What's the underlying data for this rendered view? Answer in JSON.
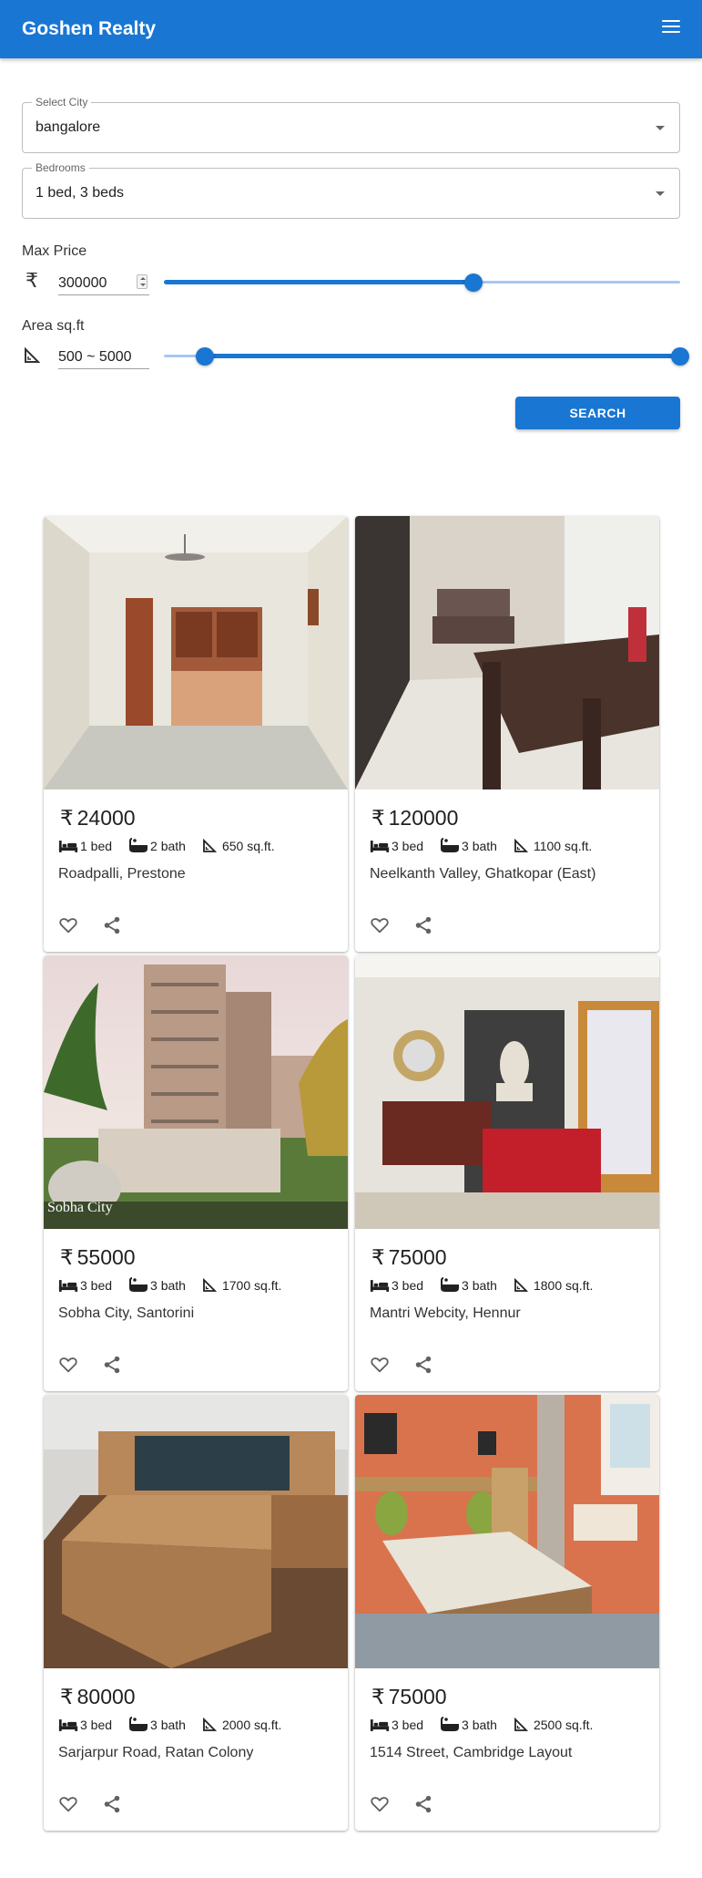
{
  "app": {
    "title": "Goshen Realty"
  },
  "filters": {
    "city": {
      "label": "Select City",
      "value": "bangalore"
    },
    "bedrooms": {
      "label": "Bedrooms",
      "value": "1 bed, 3 beds"
    },
    "max_price": {
      "label": "Max Price",
      "currency": "₹",
      "value": "300000",
      "slider_fraction": 0.6
    },
    "area": {
      "label": "Area sq.ft",
      "value": "500 ~ 5000",
      "range_fraction": [
        0.08,
        1.0
      ]
    },
    "search_label": "SEARCH"
  },
  "colors": {
    "primary": "#1976d2",
    "primary_light": "#a6c8ee"
  },
  "listings": [
    {
      "currency": "₹",
      "price": "24000",
      "beds": "1 bed",
      "baths": "2 bath",
      "area": "650 sq.ft.",
      "location": "Roadpalli, Prestone",
      "photo": "empty-room"
    },
    {
      "currency": "₹",
      "price": "120000",
      "beds": "3 bed",
      "baths": "3 bath",
      "area": "1100 sq.ft.",
      "location": "Neelkanth Valley, Ghatkopar (East)",
      "photo": "dining-room"
    },
    {
      "currency": "₹",
      "price": "55000",
      "beds": "3 bed",
      "baths": "3 bath",
      "area": "1700 sq.ft.",
      "location": "Sobha City, Santorini",
      "photo": "apartment-towers",
      "photo_caption": "Sobha City"
    },
    {
      "currency": "₹",
      "price": "75000",
      "beds": "3 bed",
      "baths": "3 bath",
      "area": "1800 sq.ft.",
      "location": "Mantri Webcity, Hennur",
      "photo": "living-room-buddha"
    },
    {
      "currency": "₹",
      "price": "80000",
      "beds": "3 bed",
      "baths": "3 bath",
      "area": "2000 sq.ft.",
      "location": "Sarjarpur Road, Ratan Colony",
      "photo": "wooden-bed"
    },
    {
      "currency": "₹",
      "price": "75000",
      "beds": "3 bed",
      "baths": "3 bath",
      "area": "2500 sq.ft.",
      "location": "1514 Street, Cambridge Layout",
      "photo": "orange-bedroom"
    }
  ]
}
